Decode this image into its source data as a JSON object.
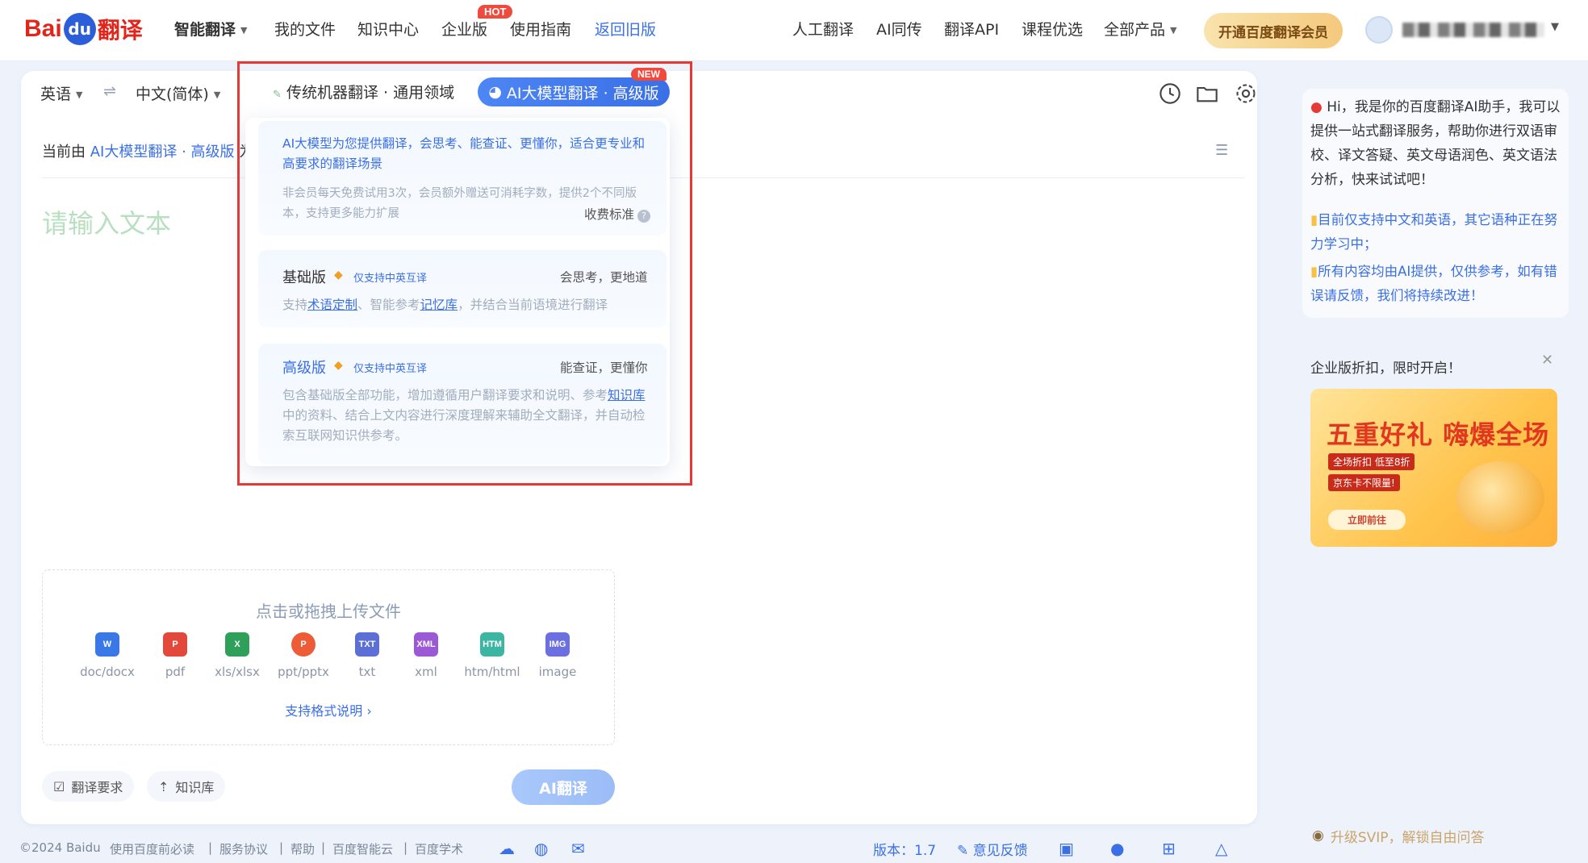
{
  "header": {
    "logo": {
      "bai": "Bai",
      "du": "du",
      "fanyi": "翻译"
    },
    "nav": [
      {
        "label": "智能翻译",
        "dropdown": true,
        "active": true
      },
      {
        "label": "我的文件"
      },
      {
        "label": "知识中心"
      },
      {
        "label": "企业版",
        "badge": "HOT"
      },
      {
        "label": "使用指南"
      },
      {
        "label": "返回旧版",
        "highlight": true
      }
    ],
    "right_nav": [
      {
        "label": "人工翻译"
      },
      {
        "label": "AI同传"
      },
      {
        "label": "翻译API"
      },
      {
        "label": "课程优选"
      },
      {
        "label": "全部产品",
        "dropdown": true
      }
    ],
    "vip_button": "开通百度翻译会员"
  },
  "langbar": {
    "source": "英语",
    "target": "中文(简体)",
    "swap": "⇌",
    "model_traditional": "传统机器翻译 · 通用领域",
    "model_ai": "AI大模型翻译 · 高级版",
    "new_badge": "NEW"
  },
  "editor": {
    "current_prefix": "当前由",
    "current_model": "AI大模型翻译 · 高级版",
    "current_suffix": "为",
    "placeholder": "请输入文本"
  },
  "upload": {
    "title": "点击或拖拽上传文件",
    "types": [
      {
        "label": "doc/docx",
        "icon": "W",
        "color": "#3b78e7"
      },
      {
        "label": "pdf",
        "icon": "P",
        "color": "#e2493a"
      },
      {
        "label": "xls/xlsx",
        "icon": "X",
        "color": "#2fa05a"
      },
      {
        "label": "ppt/pptx",
        "icon": "P",
        "color": "#ee5b37"
      },
      {
        "label": "txt",
        "icon": "TXT",
        "color": "#5c6fd6"
      },
      {
        "label": "xml",
        "icon": "XML",
        "color": "#9b59d6"
      },
      {
        "label": "htm/html",
        "icon": "HTM",
        "color": "#3db5a3"
      },
      {
        "label": "image",
        "icon": "IMG",
        "color": "#6b6fe0"
      }
    ],
    "formats_link": "支持格式说明 ›"
  },
  "bottom": {
    "requirements": "翻译要求",
    "knowledge": "知识库",
    "ai_translate": "AI翻译"
  },
  "dropdown": {
    "intro_desc": "AI大模型为您提供翻译，会思考、能查证、更懂你，适合更专业和高要求的翻译场景",
    "intro_note": "非会员每天免费试用3次，会员额外赠送可消耗字数，提供2个不同版本，支持更多能力扩展",
    "fee_link": "收费标准",
    "basic": {
      "title": "基础版",
      "badge": "仅支持中英互译",
      "slogan": "会思考，更地道",
      "desc_pre": "支持",
      "link1": "术语定制",
      "desc_mid": "、智能参考",
      "link2": "记忆库",
      "desc_post": "，并结合当前语境进行翻译"
    },
    "advanced": {
      "title": "高级版",
      "badge": "仅支持中英互译",
      "slogan": "能查证，更懂你",
      "desc_pre": "包含基础版全部功能，增加遵循用户翻译要求和说明、参考",
      "link": "知识库",
      "desc_post": "中的资料、结合上文内容进行深度理解来辅助全文翻译，并自动检索互联网知识供参考。"
    }
  },
  "assistant": {
    "greeting": "Hi，我是你的百度翻译AI助手，我可以提供一站式翻译服务，帮助你进行双语审校、译文答疑、英文母语润色、英文语法分析，快来试试吧！",
    "tip1": "目前仅支持中文和英语，其它语种正在努力学习中；",
    "tip2": "所有内容均由AI提供，仅供参考，如有错误请反馈，我们将持续改进！"
  },
  "promo": {
    "title": "企业版折扣，限时开启！",
    "headline": "五重好礼 嗨爆全场",
    "sub1": "全场折扣  低至8折",
    "sub2": "京东卡不限量!",
    "go": "立即前往"
  },
  "svip": "升级SVIP，解锁自由问答",
  "footer": {
    "items": [
      "©2024 Baidu",
      "使用百度前必读",
      "|",
      "服务协议",
      "|",
      "帮助",
      "|",
      "百度智能云",
      "|",
      "百度学术"
    ],
    "version": "版本：1.7",
    "feedback": "意见反馈"
  },
  "colors": {
    "accent": "#3a6fe6",
    "brand_red": "#e1251b",
    "highlight_box": "#e53935"
  }
}
